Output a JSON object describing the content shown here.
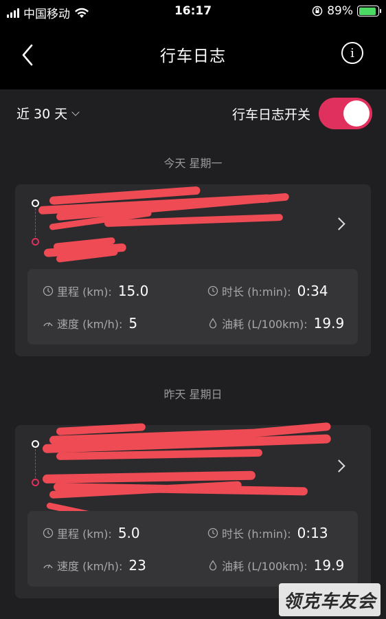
{
  "status_bar": {
    "carrier": "中国移动",
    "time": "16:17",
    "battery_percent": "89%",
    "battery_level": 0.89,
    "icons": [
      "signal-icon",
      "wifi-icon",
      "orientation-lock-icon",
      "battery-charging-icon"
    ]
  },
  "nav": {
    "title": "行车日志",
    "back_icon": "chevron-left-icon",
    "info_label": "i"
  },
  "filter": {
    "range_label": "近 30 天",
    "toggle_label": "行车日志开关",
    "toggle_on": true
  },
  "days": [
    {
      "header": "今天  星期一",
      "trip": {
        "from": "",
        "to": "",
        "stats": {
          "mileage_label": "里程 (km):",
          "mileage_value": "15.0",
          "duration_label": "时长 (h:min):",
          "duration_value": "0:34",
          "speed_label": "速度 (km/h):",
          "speed_value": "5",
          "fuel_label": "油耗 (L/100km):",
          "fuel_value": "19.9"
        }
      }
    },
    {
      "header": "昨天  星期日",
      "trip": {
        "from": "",
        "to": "",
        "stats": {
          "mileage_label": "里程 (km):",
          "mileage_value": "5.0",
          "duration_label": "时长 (h:min):",
          "duration_value": "0:13",
          "speed_label": "速度 (km/h):",
          "speed_value": "23",
          "fuel_label": "油耗 (L/100km):",
          "fuel_value": "19.9"
        }
      }
    }
  ],
  "watermark": "领克车友会",
  "colors": {
    "accent": "#e0305d",
    "background": "#1f1f21",
    "card": "#2b2b2e",
    "stats_box": "#353538",
    "redaction": "#ee4b55"
  }
}
